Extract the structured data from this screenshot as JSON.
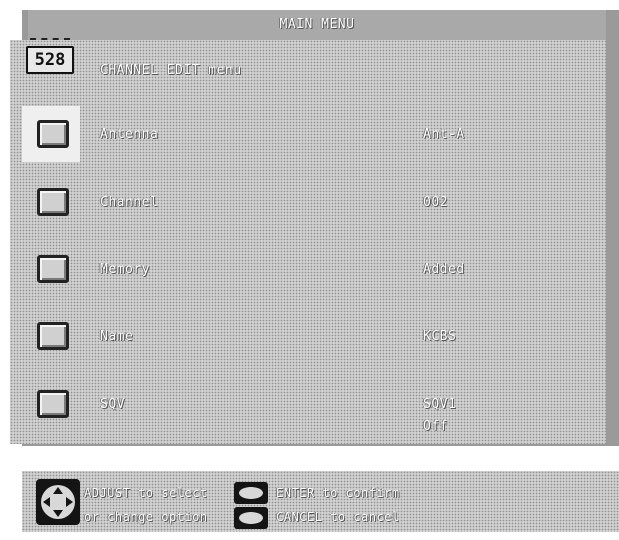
{
  "title": "MAIN MENU",
  "section_title": "CHANNEL EDIT menu",
  "channel_badge": "528",
  "rows": [
    {
      "label": "Antenna",
      "value": "Ant-A",
      "value2": ""
    },
    {
      "label": "Channel",
      "value": "002",
      "value2": ""
    },
    {
      "label": "Memory",
      "value": "Added",
      "value2": ""
    },
    {
      "label": "Name",
      "value": "KCBS",
      "value2": ""
    },
    {
      "label": "SQV",
      "value": "SQV1",
      "value2": "Off"
    }
  ],
  "help": {
    "adjust_line1": "ADJUST to select",
    "adjust_line2": "or change option",
    "enter_text": "ENTER to confirm",
    "cancel_text": "CANCEL to cancel"
  },
  "icons": {
    "dpad": "dpad-icon",
    "enter": "enter-button-icon",
    "cancel": "cancel-button-icon",
    "tv": "tv-channel-icon"
  }
}
